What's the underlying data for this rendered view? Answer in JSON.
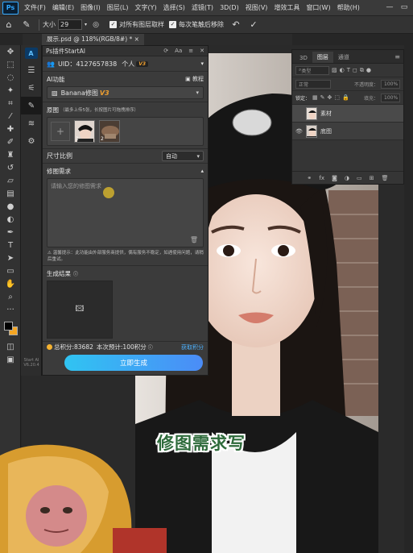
{
  "menubar": {
    "logo": "Ps",
    "items": [
      "文件(F)",
      "编辑(E)",
      "图像(I)",
      "图层(L)",
      "文字(Y)",
      "选择(S)",
      "滤镜(T)",
      "3D(D)",
      "视图(V)",
      "增效工具",
      "窗口(W)",
      "帮助(H)"
    ]
  },
  "optbar": {
    "size_label": "大小",
    "size_value": "29",
    "sample_all_layers": "对所有图层取样",
    "auto_clean": "每次笔触后移除"
  },
  "document": {
    "tab_title": "展示.psd @ 118%(RGB/8#) *"
  },
  "plugin": {
    "title": "Ps插件StartAI",
    "uid": "UID：4127657838",
    "account": "个人",
    "account_tier": "V3",
    "ai_function": {
      "label": "AI功能",
      "tutorial": "教程",
      "model": "Banana修图",
      "model_version": "V3"
    },
    "source": {
      "label": "原图",
      "hint": "（最多上传5张，长按图片可拖拽排序）",
      "thumbnails": [
        "1",
        "2"
      ]
    },
    "ratio": {
      "label": "尺寸比例",
      "value": "自动"
    },
    "prompt": {
      "label": "修图需求",
      "placeholder": "请输入您的修图需求",
      "notice": "温馨提示：此功能由外部服务商提供，偶有服务不稳定，如遇使用问题，请稍后重试。"
    },
    "result": {
      "label": "生成结果"
    },
    "points": {
      "total": "总积分:83682",
      "estimate": "本次预计:100积分",
      "earn": "获取积分"
    },
    "generate_button": "立即生成",
    "version": "Start AI\nV6.20.4"
  },
  "layers": {
    "tabs": [
      "3D",
      "图层",
      "通道"
    ],
    "active_tab": "图层",
    "filter_kind": "类型",
    "blend_mode": "正常",
    "opacity_label": "不透明度：",
    "opacity_value": "100%",
    "lock_label": "锁定：",
    "fill_label": "填充：",
    "fill_value": "100%",
    "items": [
      {
        "name": "素材",
        "visible": false
      },
      {
        "name": "底图",
        "visible": true
      }
    ]
  },
  "caption": "修图需求写"
}
